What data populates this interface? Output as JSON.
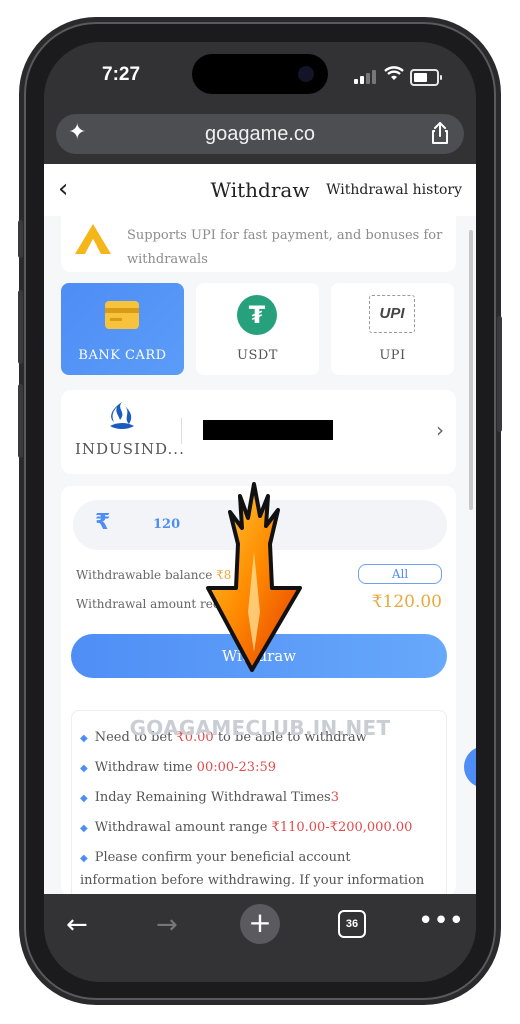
{
  "status": {
    "time": "7:27"
  },
  "browser": {
    "url": "goagame.co",
    "tab_count": "36"
  },
  "page": {
    "title": "Withdraw",
    "history_label": "Withdrawal history",
    "notice": "Supports UPI for fast payment, and bonuses for withdrawals",
    "methods": [
      {
        "label": "BANK CARD"
      },
      {
        "label": "USDT"
      },
      {
        "label": "UPI"
      }
    ],
    "upi_logo_text": "UPI",
    "bank_name": "INDUSIND...",
    "amount_symbol": "₹",
    "amount_value": "120",
    "withdrawable_label": "Withdrawable balance",
    "withdrawable_value": "₹8",
    "all_label": "All",
    "received_label": "Withdrawal amount received",
    "received_value": "₹120.00",
    "withdraw_button": "Withdraw",
    "watermark": "GOAGAMECLUB.IN.NET",
    "rules": [
      {
        "pre": "Need to bet ",
        "hl": "₹0.00",
        "post": " to be able to withdraw"
      },
      {
        "pre": "Withdraw time ",
        "hl": "00:00-23:59",
        "post": ""
      },
      {
        "pre": "Inday Remaining Withdrawal Times",
        "hl": "3",
        "post": ""
      },
      {
        "pre": "Withdrawal amount range ",
        "hl": "₹110.00-₹200,000.00",
        "post": ""
      },
      {
        "pre": "Please confirm your beneficial account information before withdrawing. If your information is incorrect,",
        "hl": "",
        "post": ""
      }
    ]
  },
  "colors": {
    "accent": "#4e8df5",
    "highlight": "#e24b4b",
    "amount": "#e8a93b"
  },
  "icons": [
    "ai-sparkle-icon",
    "share-icon",
    "back-chevron-icon",
    "bank-card-icon",
    "usdt-icon",
    "upi-icon",
    "bank-logo-icon",
    "chevron-right-icon",
    "rupee-icon",
    "arrow-down-annotation",
    "back-arrow-icon",
    "forward-arrow-icon",
    "new-tab-icon",
    "tabs-icon",
    "more-icon"
  ]
}
